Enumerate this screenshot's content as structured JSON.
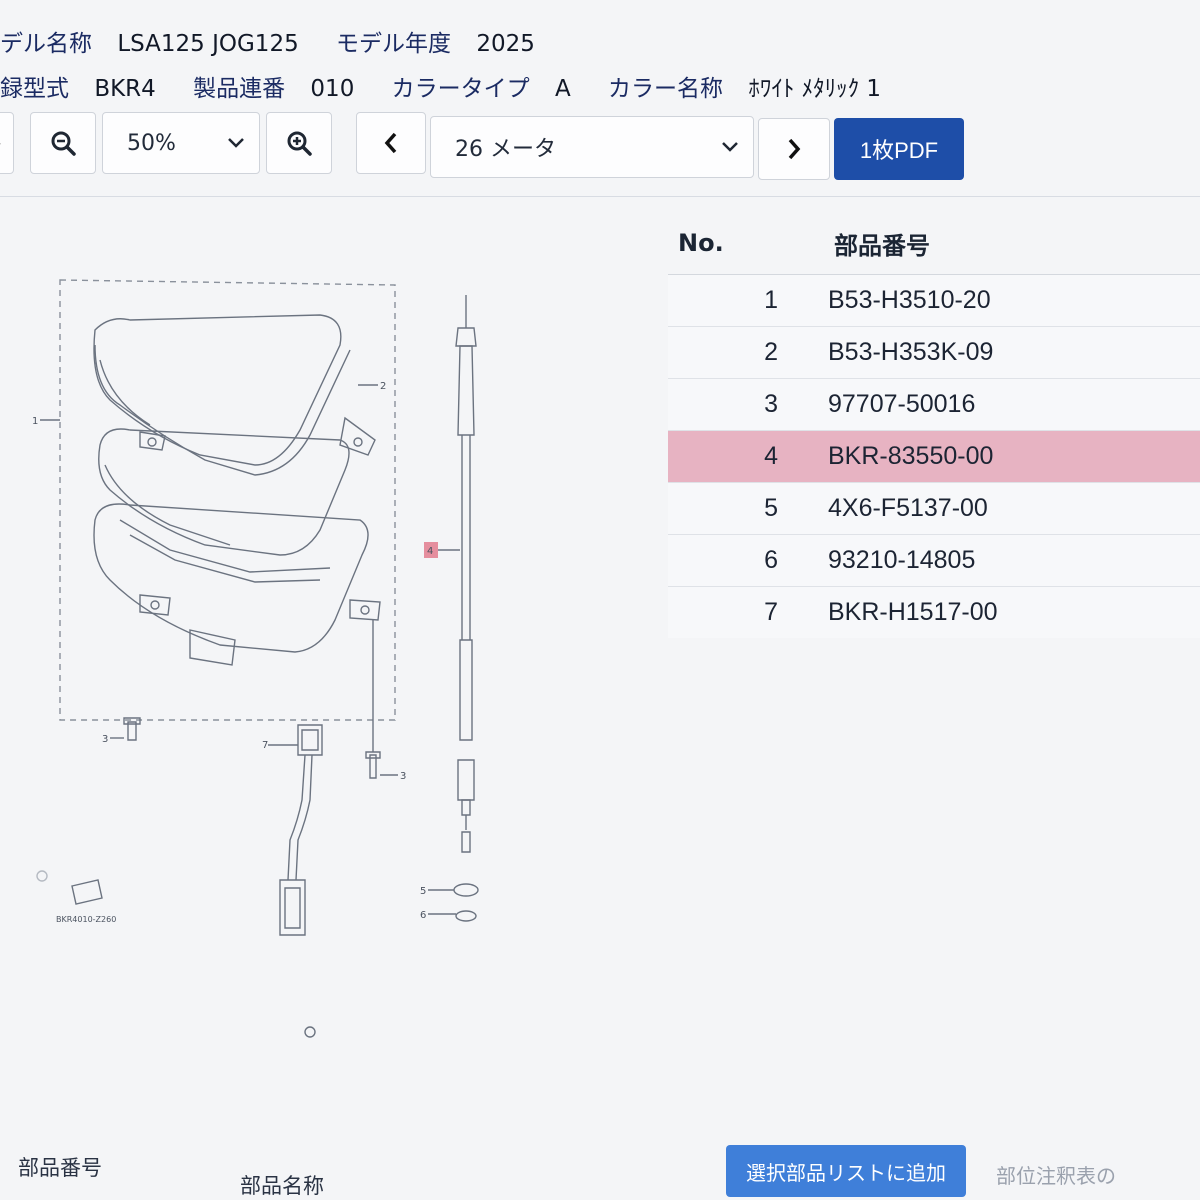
{
  "info": {
    "model_name_label": "デル名称",
    "model_name_value": "LSA125 JOG125",
    "model_year_label": "モデル年度",
    "model_year_value": "2025",
    "reg_type_label": "録型式",
    "reg_type_value": "BKR4",
    "serial_label": "製品連番",
    "serial_value": "010",
    "color_type_label": "カラータイプ",
    "color_type_value": "A",
    "color_name_label": "カラー名称",
    "color_name_value": "ﾎﾜｲﾄ ﾒﾀﾘｯｸ 1"
  },
  "toolbar": {
    "zoom_value": "50%",
    "page_value": "26 メータ",
    "pdf_label": "1枚PDF"
  },
  "table": {
    "header_no": "No.",
    "header_part": "部品番号",
    "rows": [
      {
        "no": "1",
        "part": "B53-H3510-20"
      },
      {
        "no": "2",
        "part": "B53-H353K-09"
      },
      {
        "no": "3",
        "part": "97707-50016"
      },
      {
        "no": "4",
        "part": "BKR-83550-00"
      },
      {
        "no": "5",
        "part": "4X6-F5137-00"
      },
      {
        "no": "6",
        "part": "93210-14805"
      },
      {
        "no": "7",
        "part": "BKR-H1517-00"
      }
    ]
  },
  "diagram": {
    "callouts": [
      "1",
      "2",
      "3",
      "7",
      "3",
      "4",
      "5",
      "6"
    ],
    "figure_code": "BKR4010-Z260"
  },
  "bottom": {
    "col_part_no": "部品番号",
    "col_part_name": "部品名称",
    "add_button": "選択部品リストに追加",
    "note": "部位注釈表の"
  },
  "colors": {
    "primary": "#1e4ea8",
    "highlight_row": "#e7b3c2",
    "add_button": "#3f7fd9"
  },
  "icons": [
    "refresh-icon",
    "zoom-out-icon",
    "chevron-down-icon",
    "zoom-in-icon",
    "chevron-left-icon",
    "chevron-right-icon"
  ]
}
